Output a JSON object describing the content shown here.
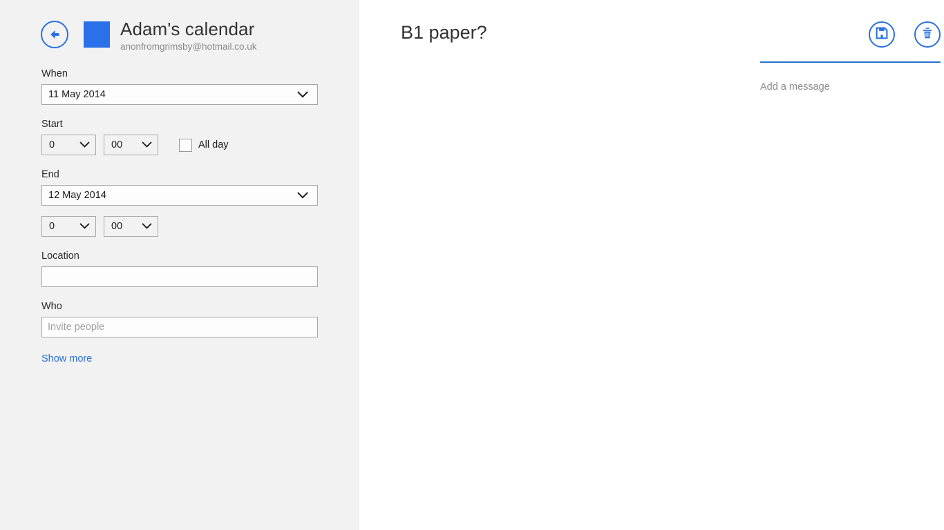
{
  "colors": {
    "accent_blue": "#2a70e8",
    "link_blue": "#2a6fdb",
    "panel_bg": "#f2f2f2",
    "content_bg": "#ffffff",
    "text_primary": "#333333",
    "text_muted": "#8a8a8a",
    "field_border": "#a6a6a6"
  },
  "calendar_header": {
    "back_label": "Back",
    "calendar_name": "Adam's calendar",
    "account_email": "anonfromgrimsby@hotmail.co.uk",
    "swatch_color": "#2a70e8"
  },
  "form": {
    "when": {
      "label": "When",
      "value": "11 May 2014"
    },
    "start": {
      "label": "Start",
      "hour": "0",
      "minute": "00",
      "all_day_label": "All day",
      "all_day_checked": false
    },
    "end": {
      "label": "End",
      "date_value": "12 May 2014",
      "hour": "0",
      "minute": "00"
    },
    "location": {
      "label": "Location",
      "value": "",
      "placeholder": ""
    },
    "who": {
      "label": "Who",
      "value": "",
      "placeholder": "Invite people"
    },
    "show_more_label": "Show more"
  },
  "details": {
    "subject": "B1 paper?",
    "message_placeholder": "Add a message",
    "actions": {
      "save_label": "Save",
      "delete_label": "Delete"
    }
  }
}
